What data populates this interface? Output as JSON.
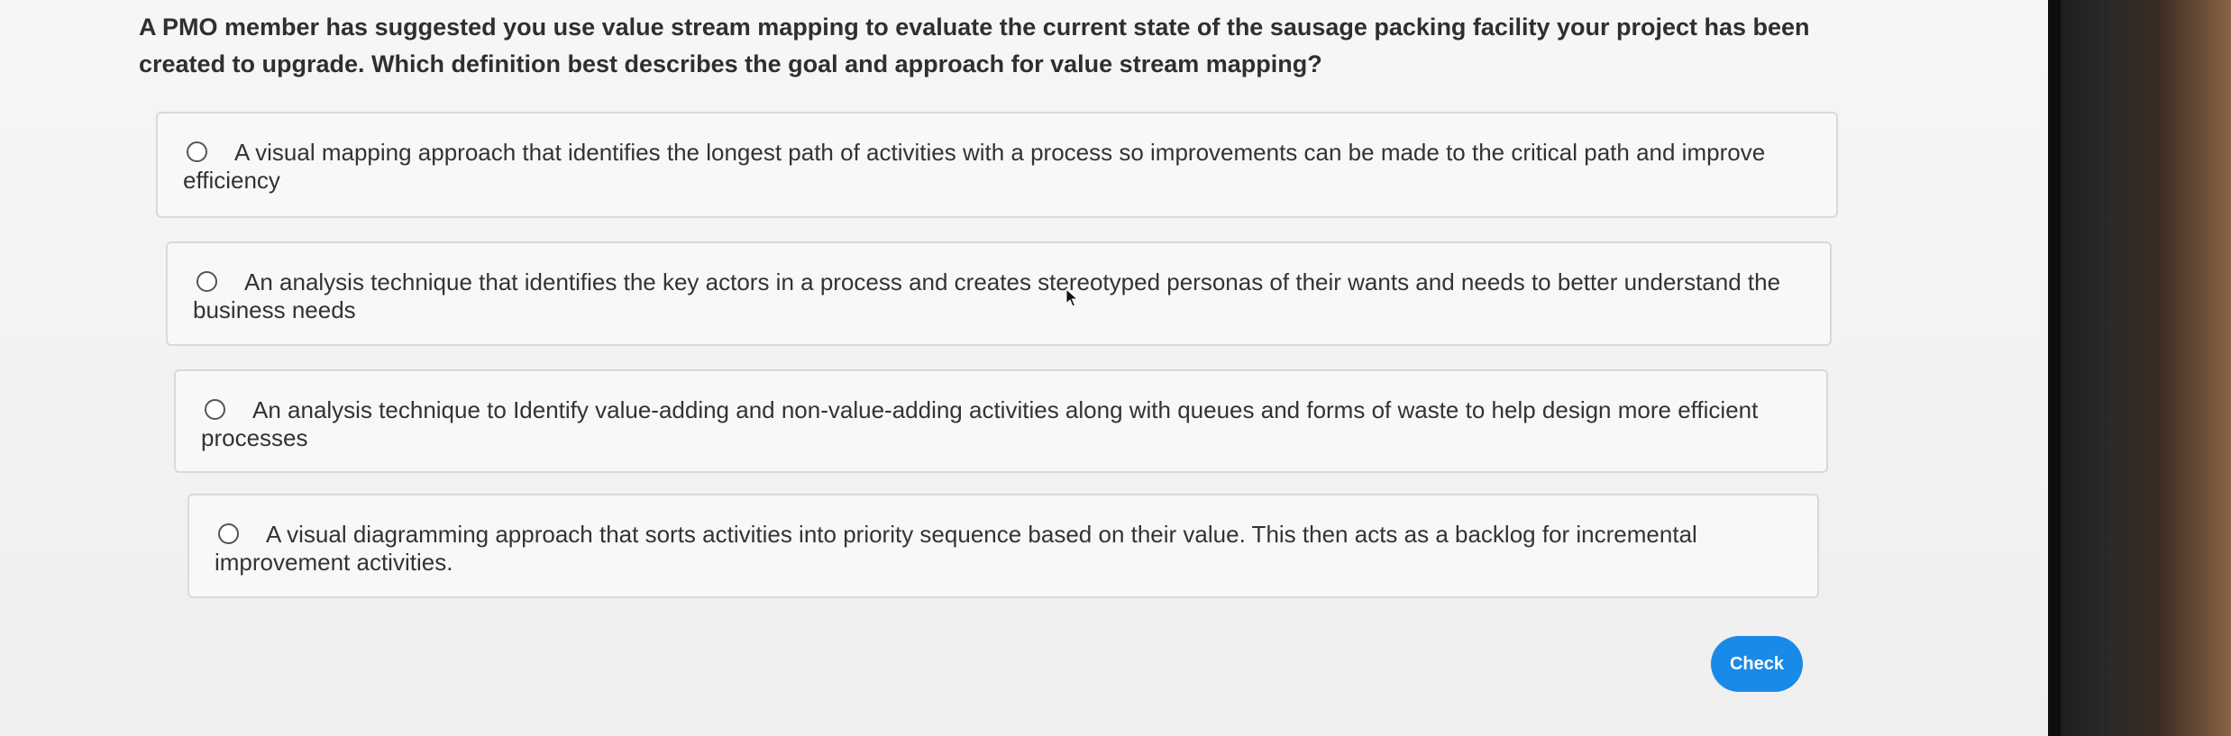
{
  "question": {
    "text": "A PMO member has suggested you use value stream mapping to evaluate the current state of the sausage packing facility your project has been created to upgrade. Which definition best describes the goal and approach for value stream mapping?"
  },
  "options": [
    {
      "label": "A visual mapping approach that identifies the longest path of activities with a process so improvements can be made to the critical path and improve efficiency",
      "selected": false
    },
    {
      "label": "An analysis technique that identifies the key actors in a process and creates stereotyped personas of their wants and needs to better understand the business needs",
      "selected": false
    },
    {
      "label": "An analysis technique to Identify value-adding and non-value-adding activities along with queues and forms of waste to help design more efficient processes",
      "selected": false
    },
    {
      "label": "A visual diagramming approach that sorts activities into priority sequence based on their value. This then acts as a backlog for incremental improvement activities.",
      "selected": false
    }
  ],
  "actions": {
    "check_label": "Check"
  },
  "colors": {
    "accent": "#1a8ae8",
    "text": "#333333",
    "border": "#d9d9d9"
  },
  "icons": {
    "radio": "radio-unselected-icon",
    "cursor": "mouse-pointer-icon"
  }
}
